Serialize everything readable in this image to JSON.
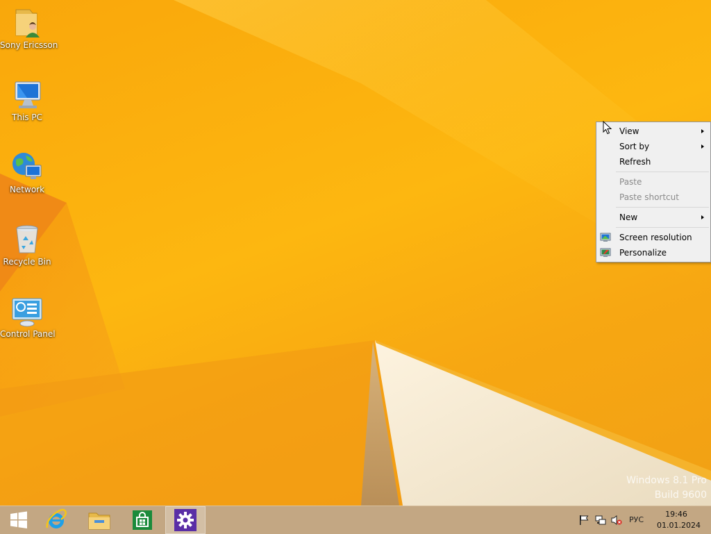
{
  "desktop": {
    "icons": [
      {
        "label": "Sony Ericsson",
        "icon": "user-folder-icon"
      },
      {
        "label": "This PC",
        "icon": "computer-icon"
      },
      {
        "label": "Network",
        "icon": "network-globe-icon"
      },
      {
        "label": "Recycle Bin",
        "icon": "recycle-bin-icon"
      },
      {
        "label": "Control Panel",
        "icon": "control-panel-icon"
      }
    ],
    "watermark": {
      "line1": "Windows 8.1 Pro",
      "line2": "Build 9600"
    },
    "colors": {
      "wallpaper": "#fdb710",
      "taskbar": "#c3a783"
    }
  },
  "context_menu": {
    "items": [
      {
        "label": "View",
        "submenu": true,
        "enabled": true
      },
      {
        "label": "Sort by",
        "submenu": true,
        "enabled": true
      },
      {
        "label": "Refresh",
        "submenu": false,
        "enabled": true
      },
      {
        "label": "Paste",
        "submenu": false,
        "enabled": false
      },
      {
        "label": "Paste shortcut",
        "submenu": false,
        "enabled": false
      },
      {
        "label": "New",
        "submenu": true,
        "enabled": true
      },
      {
        "label": "Screen resolution",
        "submenu": false,
        "enabled": true,
        "icon": "display-settings-icon"
      },
      {
        "label": "Personalize",
        "submenu": false,
        "enabled": true,
        "icon": "personalize-icon"
      }
    ]
  },
  "taskbar": {
    "buttons": [
      {
        "name": "start",
        "icon": "windows-logo-icon"
      },
      {
        "name": "internet-explorer",
        "icon": "internet-explorer-icon"
      },
      {
        "name": "file-explorer",
        "icon": "file-explorer-icon"
      },
      {
        "name": "store",
        "icon": "store-icon"
      },
      {
        "name": "settings",
        "icon": "settings-gear-icon",
        "active": true
      }
    ],
    "tray": {
      "icons": [
        "action-center-flag-icon",
        "network-icon",
        "volume-muted-icon"
      ],
      "language": "РУС",
      "time": "19:46",
      "date": "01.01.2024"
    }
  }
}
